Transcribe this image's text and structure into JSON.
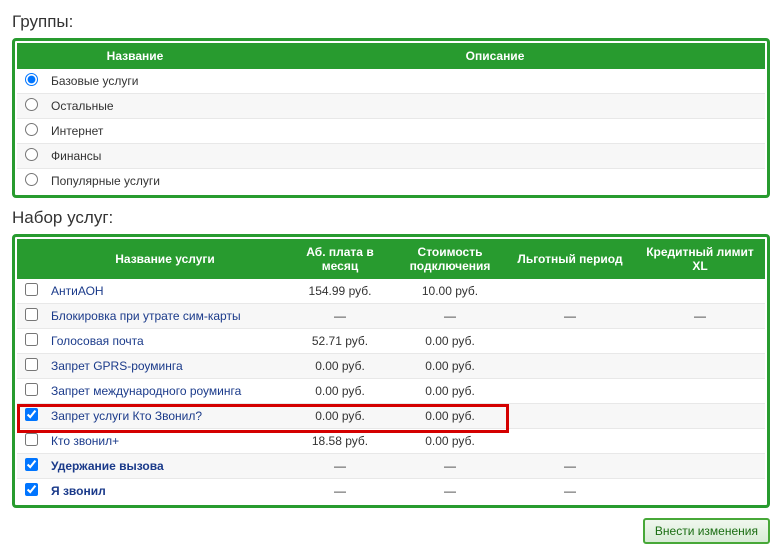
{
  "groups": {
    "title": "Группы:",
    "headers": {
      "name": "Название",
      "desc": "Описание"
    },
    "rows": [
      {
        "label": "Базовые услуги",
        "selected": true
      },
      {
        "label": "Остальные",
        "selected": false
      },
      {
        "label": "Интернет",
        "selected": false
      },
      {
        "label": "Финансы",
        "selected": false
      },
      {
        "label": "Популярные услуги",
        "selected": false
      }
    ]
  },
  "services": {
    "title": "Набор услуг:",
    "headers": {
      "name": "Название услуги",
      "monthly": "Аб. плата в месяц",
      "connect_cost": "Стоимость подключения",
      "grace": "Льготный период",
      "credit": "Кредитный лимит XL"
    },
    "rows": [
      {
        "label": "АнтиАОН",
        "checked": false,
        "bold": false,
        "monthly": "154.99 руб.",
        "connect": "10.00 руб.",
        "grace": "",
        "credit": "",
        "highlight": false
      },
      {
        "label": "Блокировка при утрате сим-карты",
        "checked": false,
        "bold": false,
        "monthly": "—",
        "connect": "—",
        "grace": "—",
        "credit": "—",
        "highlight": false
      },
      {
        "label": "Голосовая почта",
        "checked": false,
        "bold": false,
        "monthly": "52.71 руб.",
        "connect": "0.00 руб.",
        "grace": "",
        "credit": "",
        "highlight": false
      },
      {
        "label": "Запрет GPRS-роуминга",
        "checked": false,
        "bold": false,
        "monthly": "0.00 руб.",
        "connect": "0.00 руб.",
        "grace": "",
        "credit": "",
        "highlight": false
      },
      {
        "label": "Запрет международного роуминга",
        "checked": false,
        "bold": false,
        "monthly": "0.00 руб.",
        "connect": "0.00 руб.",
        "grace": "",
        "credit": "",
        "highlight": false
      },
      {
        "label": "Запрет услуги Кто Звонил?",
        "checked": true,
        "bold": false,
        "monthly": "0.00 руб.",
        "connect": "0.00 руб.",
        "grace": "",
        "credit": "",
        "highlight": true
      },
      {
        "label": "Кто звонил+",
        "checked": false,
        "bold": false,
        "monthly": "18.58 руб.",
        "connect": "0.00 руб.",
        "grace": "",
        "credit": "",
        "highlight": false
      },
      {
        "label": "Удержание вызова",
        "checked": true,
        "bold": true,
        "monthly": "—",
        "connect": "—",
        "grace": "—",
        "credit": "",
        "highlight": false
      },
      {
        "label": "Я звонил",
        "checked": true,
        "bold": true,
        "monthly": "—",
        "connect": "—",
        "grace": "—",
        "credit": "",
        "highlight": false
      }
    ]
  },
  "submit_label": "Внести изменения"
}
